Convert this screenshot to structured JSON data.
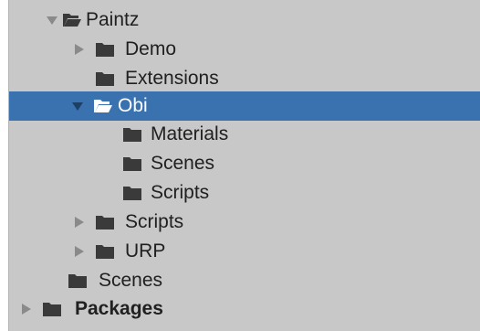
{
  "colors": {
    "panel_bg": "#c8c8c8",
    "selected_bg": "#3a72b0",
    "text": "#202020",
    "icon": "#3a3a3a",
    "arrow": "#8a8a8a"
  },
  "tree": {
    "items": [
      {
        "label": "Paintz",
        "expanded": true,
        "open_folder": true,
        "icon": "folder-open-icon"
      },
      {
        "label": "Demo",
        "expanded": false,
        "icon": "folder-icon"
      },
      {
        "label": "Extensions",
        "icon": "folder-icon"
      },
      {
        "label": "Obi",
        "expanded": true,
        "selected": true,
        "icon": "folder-open-icon"
      },
      {
        "label": "Materials",
        "icon": "folder-icon"
      },
      {
        "label": "Scenes",
        "icon": "folder-icon"
      },
      {
        "label": "Scripts",
        "icon": "folder-icon"
      },
      {
        "label": "Scripts",
        "expanded": false,
        "icon": "folder-icon"
      },
      {
        "label": "URP",
        "expanded": false,
        "icon": "folder-icon"
      },
      {
        "label": "Scenes",
        "icon": "folder-icon"
      },
      {
        "label": "Packages",
        "expanded": false,
        "bold": true,
        "icon": "folder-icon"
      }
    ]
  }
}
